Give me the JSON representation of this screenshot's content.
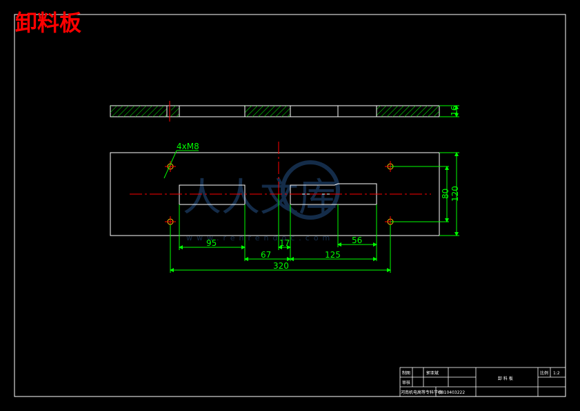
{
  "drawing": {
    "title": "卸料板",
    "watermark": {
      "text": "人人文库",
      "url": "www.renrendoc.com"
    },
    "top_view": {
      "thickness_label": "16"
    },
    "front_view": {
      "hole_callout": "4xM8",
      "dims": {
        "d95": "95",
        "d17": "17",
        "d56": "56",
        "d67": "67",
        "d125": "125",
        "d320": "320",
        "d80": "80",
        "d120": "120"
      }
    },
    "title_block": {
      "label_draw": "制图",
      "name_draw": "郭亚斌",
      "label_check": "审核",
      "part_name": "卸 料 板",
      "label_scale": "比例",
      "scale": "1:2",
      "label_school": "河南机电高等专科学校",
      "drawing_no": "0810403222"
    },
    "colors": {
      "outline": "#ffffff",
      "dimension": "#00ff00",
      "center": "#ff0000",
      "hatch": "#00ff00",
      "hole": "#ffcc00"
    }
  }
}
